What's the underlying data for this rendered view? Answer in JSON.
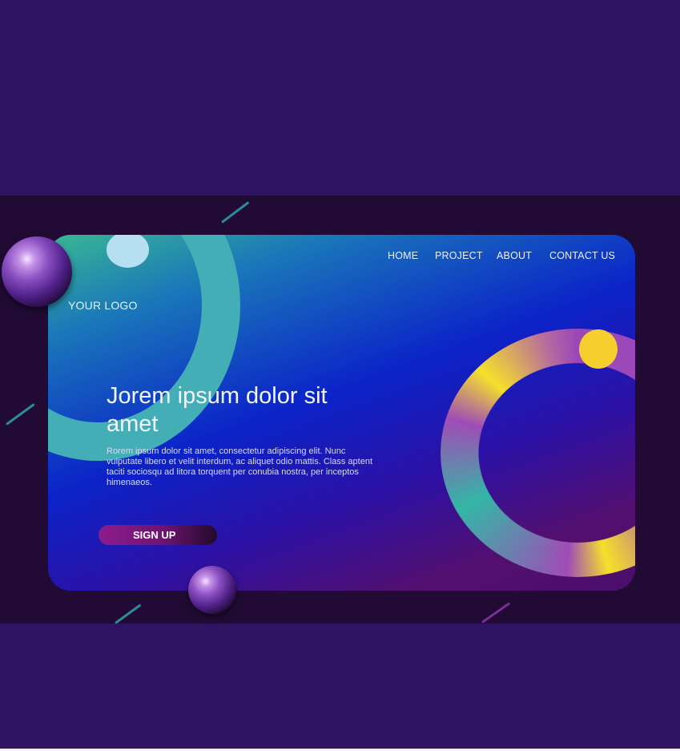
{
  "brand": {
    "logo_text": "YOUR LOGO"
  },
  "nav": {
    "items": [
      {
        "label": "HOME"
      },
      {
        "label": "PROJECT"
      },
      {
        "label": "ABOUT"
      },
      {
        "label": "CONTACT US"
      }
    ]
  },
  "hero": {
    "headline": "Jorem ipsum dolor sit amet",
    "body": "Rorem ipsum dolor sit amet, consectetur adipiscing elit. Nunc vulputate libero et velit interdum, ac aliquet odio mattis. Class aptent taciti sociosqu ad litora torquent per conubia nostra, per inceptos himenaeos.",
    "cta_label": "SIGN UP"
  },
  "colors": {
    "page_background": "#301464",
    "band_background": "#210b35",
    "accent_teal": "#43aeb5",
    "accent_yellow": "#f6cf2f",
    "accent_purple": "#8d1c8d",
    "deep_blue": "#0b23c8"
  }
}
